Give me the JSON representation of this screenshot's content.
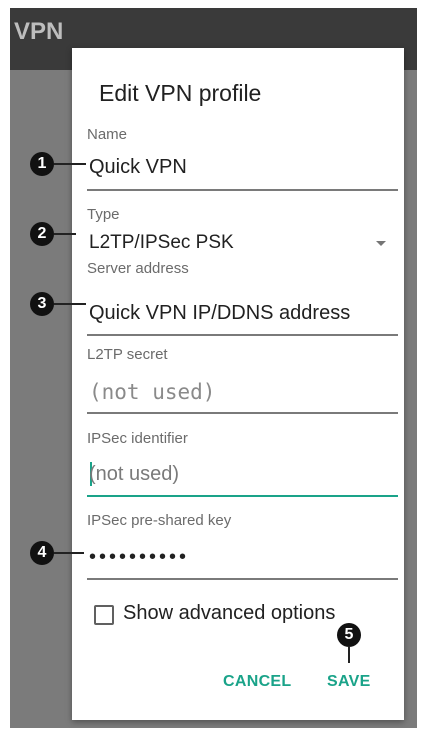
{
  "appbar": {
    "title": "VPN"
  },
  "dialog": {
    "title": "Edit VPN profile",
    "fields": {
      "name": {
        "label": "Name",
        "value": "Quick VPN"
      },
      "type": {
        "label": "Type",
        "value": "L2TP/IPSec PSK"
      },
      "server": {
        "label": "Server address",
        "value": "Quick VPN IP/DDNS address"
      },
      "l2tp_secret": {
        "label": "L2TP secret",
        "value": "(not used)"
      },
      "ipsec_identifier": {
        "label": "IPSec identifier",
        "value": "(not used)"
      },
      "psk": {
        "label": "IPSec pre-shared key",
        "value": "••••••••••"
      }
    },
    "advanced": {
      "label": "Show advanced options",
      "checked": false
    },
    "buttons": {
      "cancel": "CANCEL",
      "save": "SAVE"
    }
  },
  "callouts": [
    "1",
    "2",
    "3",
    "4",
    "5"
  ],
  "colors": {
    "accent": "#1aa389",
    "scrim": "#7b7b7b",
    "appbar": "#3a3a3a"
  }
}
